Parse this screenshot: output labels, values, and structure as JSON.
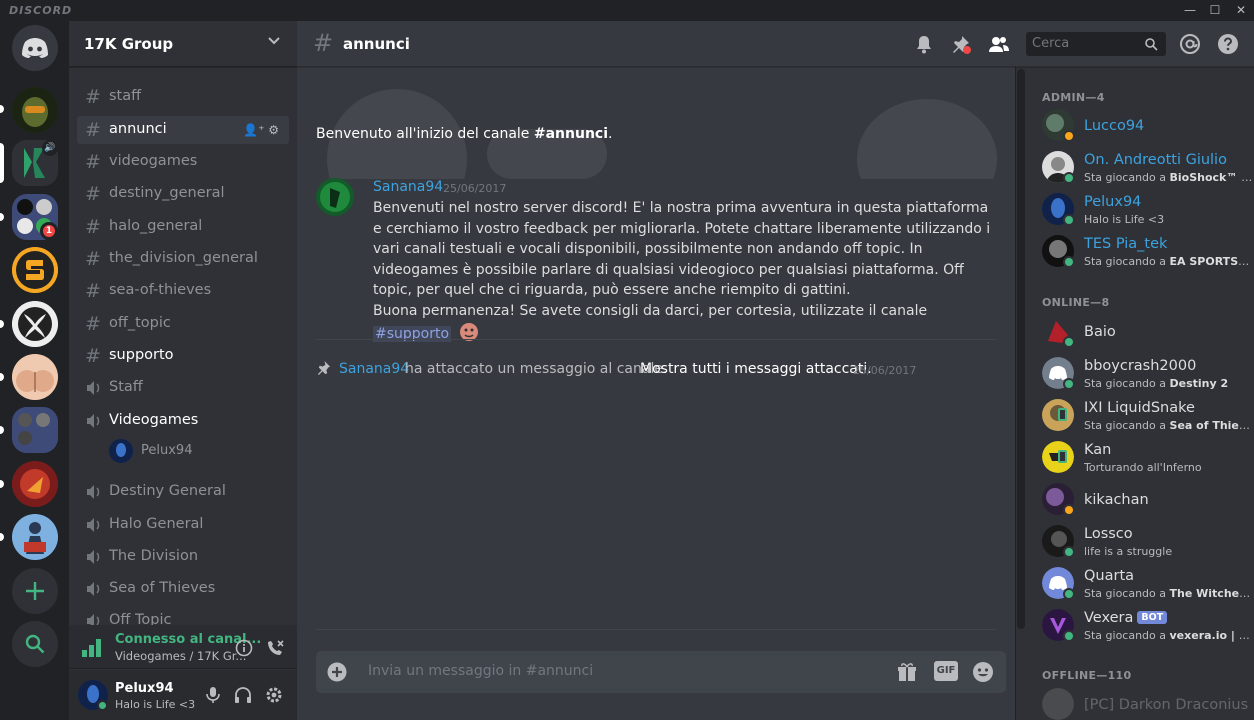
{
  "app": {
    "brand": "DISCORD"
  },
  "server": {
    "name": "17K Group"
  },
  "channels": [
    {
      "name": "staff",
      "type": "text"
    },
    {
      "name": "annunci",
      "type": "text",
      "active": true
    },
    {
      "name": "videogames",
      "type": "text"
    },
    {
      "name": "destiny_general",
      "type": "text"
    },
    {
      "name": "halo_general",
      "type": "text"
    },
    {
      "name": "the_division_general",
      "type": "text"
    },
    {
      "name": "sea-of-thieves",
      "type": "text"
    },
    {
      "name": "off_topic",
      "type": "text"
    },
    {
      "name": "supporto",
      "type": "text",
      "unread": true
    },
    {
      "name": "Staff",
      "type": "voice"
    },
    {
      "name": "Videogames",
      "type": "voice",
      "active": true
    },
    {
      "name": "Destiny General",
      "type": "voice"
    },
    {
      "name": "Halo General",
      "type": "voice"
    },
    {
      "name": "The Division",
      "type": "voice"
    },
    {
      "name": "Sea of Thieves",
      "type": "voice"
    },
    {
      "name": "Off Topic",
      "type": "voice"
    }
  ],
  "voice_users": [
    {
      "name": "Pelux94"
    }
  ],
  "guild_badge": "1",
  "voice_status": {
    "status": "Connesso al canal...",
    "channel": "Videogames / 17K Gr..."
  },
  "current_user": {
    "name": "Pelux94",
    "status": "Halo is Life <3"
  },
  "header": {
    "channel": "annunci",
    "search_placeholder": "Cerca"
  },
  "chat": {
    "welcome_prefix": "Benvenuto all'inizio del canale ",
    "welcome_channel": "#annunci",
    "welcome_suffix": ".",
    "message": {
      "author": "Sanana94",
      "timestamp": "25/06/2017",
      "text": "Benvenuti nel nostro server discord! E' la nostra prima avventura in questa piattaforma e cerchiamo il vostro feedback per migliorarla. Potete chattare liberamente utilizzando i vari canali testuali e vocali disponibili, possibilmente non andando off topic. In videogames è possibile parlare di qualsiasi videogioco per qualsiasi piattaforma. Off topic, per quel che ci riguarda, può essere anche riempito di gattini.",
      "text2": "Buona permanenza! Se avete consigli da darci, per cortesia, utilizzate il canale ",
      "mention": "#supporto"
    },
    "pin": {
      "author": "Sanana94",
      "text": "ha attaccato un messaggio al canale.",
      "link": "Mostra tutti i messaggi attaccati.",
      "timestamp": "25/06/2017"
    },
    "composer_placeholder": "Invia un messaggio in #annunci",
    "gif_label": "GIF"
  },
  "members": {
    "admin_label": "ADMIN—4",
    "online_label": "ONLINE—8",
    "offline_label": "OFFLINE—110",
    "admin": [
      {
        "name": "Lucco94",
        "status": "",
        "color": "#3ca3e0",
        "dot": "#faa61a"
      },
      {
        "name": "On. Andreotti Giulio",
        "status_prefix": "Sta giocando a ",
        "game": "BioShock™ Re...",
        "color": "#3ca3e0",
        "dot": "#43b581"
      },
      {
        "name": "Pelux94",
        "status": "Halo is Life <3",
        "color": "#3ca3e0",
        "dot": "#43b581"
      },
      {
        "name": "TES Pia_tek",
        "status_prefix": "Sta giocando a ",
        "game": "EA SPORTS™ F...",
        "color": "#3ca3e0",
        "dot": "#43b581"
      }
    ],
    "online": [
      {
        "name": "Baio",
        "status": "",
        "dot": "#43b581"
      },
      {
        "name": "bboycrash2000",
        "status_prefix": "Sta giocando a ",
        "game": "Destiny 2",
        "dot": "#43b581"
      },
      {
        "name": "IXI LiquidSnake",
        "status_prefix": "Sta giocando a ",
        "game": "Sea of Thieves",
        "dot": "mobile"
      },
      {
        "name": "Kan",
        "status": "Torturando all'Inferno",
        "dot": "mobile"
      },
      {
        "name": "kikachan",
        "status": "",
        "dot": "#faa61a"
      },
      {
        "name": "Lossco",
        "status": "life is a struggle",
        "dot": "#43b581"
      },
      {
        "name": "Quarta",
        "status_prefix": "Sta giocando a ",
        "game": "The Witcher 3: ...",
        "dot": "#43b581"
      },
      {
        "name": "Vexera",
        "bot": "BOT",
        "status_prefix": "Sta giocando a ",
        "game": "vexera.io | +help",
        "dot": "#43b581"
      }
    ],
    "offline": [
      {
        "name": "[PC] Darkon Draconius"
      }
    ]
  },
  "colors": {
    "accent": "#7289da",
    "online": "#43b581",
    "idle": "#faa61a",
    "link": "#3ca3e0"
  }
}
